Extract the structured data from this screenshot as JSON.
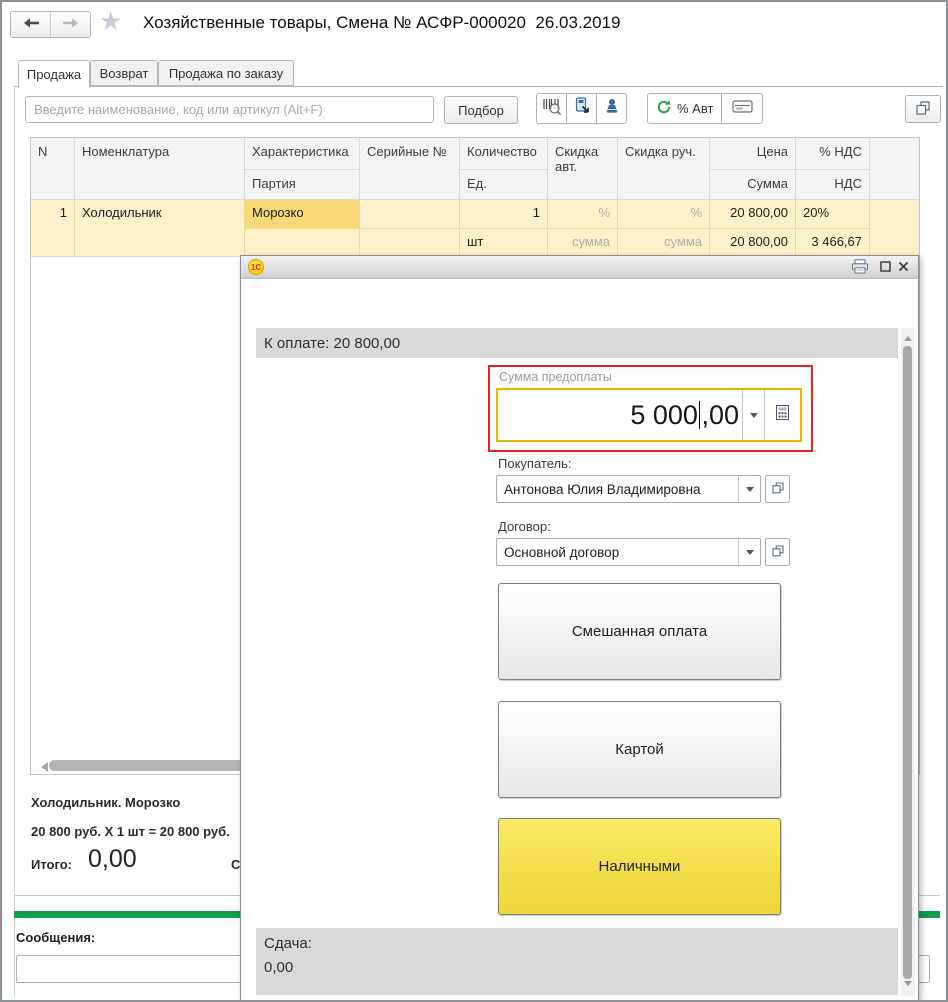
{
  "window": {
    "title": "Хозяйственные товары, Смена № АСФР-000020  26.03.2019"
  },
  "tabs": [
    {
      "label": "Продажа"
    },
    {
      "label": "Возврат"
    },
    {
      "label": "Продажа по заказу"
    }
  ],
  "toolbar": {
    "search_placeholder": "Введите наименование, код или артикул (Alt+F)",
    "podbor_label": "Подбор",
    "auto_discount_label": "% Авт"
  },
  "table": {
    "col_n": "N",
    "col_nomenclature": "Номенклатура",
    "col_characteristic": "Характеристика",
    "col_batch": "Партия",
    "col_serial": "Серийные №",
    "col_quantity": "Количество",
    "col_unit": "Ед.",
    "col_discount_auto": "Скидка авт.",
    "col_discount_manual": "Скидка руч.",
    "col_price": "Цена",
    "col_sum": "Сумма",
    "col_vat_percent": "% НДС",
    "col_vat": "НДС",
    "row": {
      "n": "1",
      "nomenclature": "Холодильник",
      "characteristic": "Морозко",
      "batch": "",
      "serial": "",
      "quantity": "1",
      "unit": "шт",
      "discount_auto_percent": "%",
      "discount_auto_sum": "сумма",
      "discount_manual_percent": "%",
      "discount_manual_sum": "сумма",
      "price": "20 800,00",
      "sum": "20 800,00",
      "vat_percent": "20%",
      "vat": "3 466,67"
    }
  },
  "summary": {
    "product_line1": "Холодильник. Морозко",
    "product_line2": "20 800 руб. Х 1 шт = 20 800 руб.",
    "total_label": "Итого:",
    "total_value": "0,00",
    "cutoff_text": "С",
    "messages_label": "Сообщения:"
  },
  "dialog": {
    "logo": "1С",
    "to_pay": "К оплате: 20 800,00",
    "prepayment": {
      "label": "Сумма предоплаты",
      "value_int": "5 000",
      "value_frac": ",00"
    },
    "buyer": {
      "label": "Покупатель:",
      "value": "Антонова Юлия Владимировна"
    },
    "contract": {
      "label": "Договор:",
      "value": "Основной договор"
    },
    "buttons": {
      "mixed": "Смешанная оплата",
      "card": "Картой",
      "cash": "Наличными"
    },
    "change": {
      "label": "Сдача:",
      "value": "0,00"
    }
  },
  "colors": {
    "accent_green": "#0f9c4b",
    "row_selected": "#fdf1c9",
    "current_cell": "#f8d977",
    "cash_button": "#f3de4a",
    "highlight_red": "#e02424",
    "focus_border": "#e9b602"
  }
}
